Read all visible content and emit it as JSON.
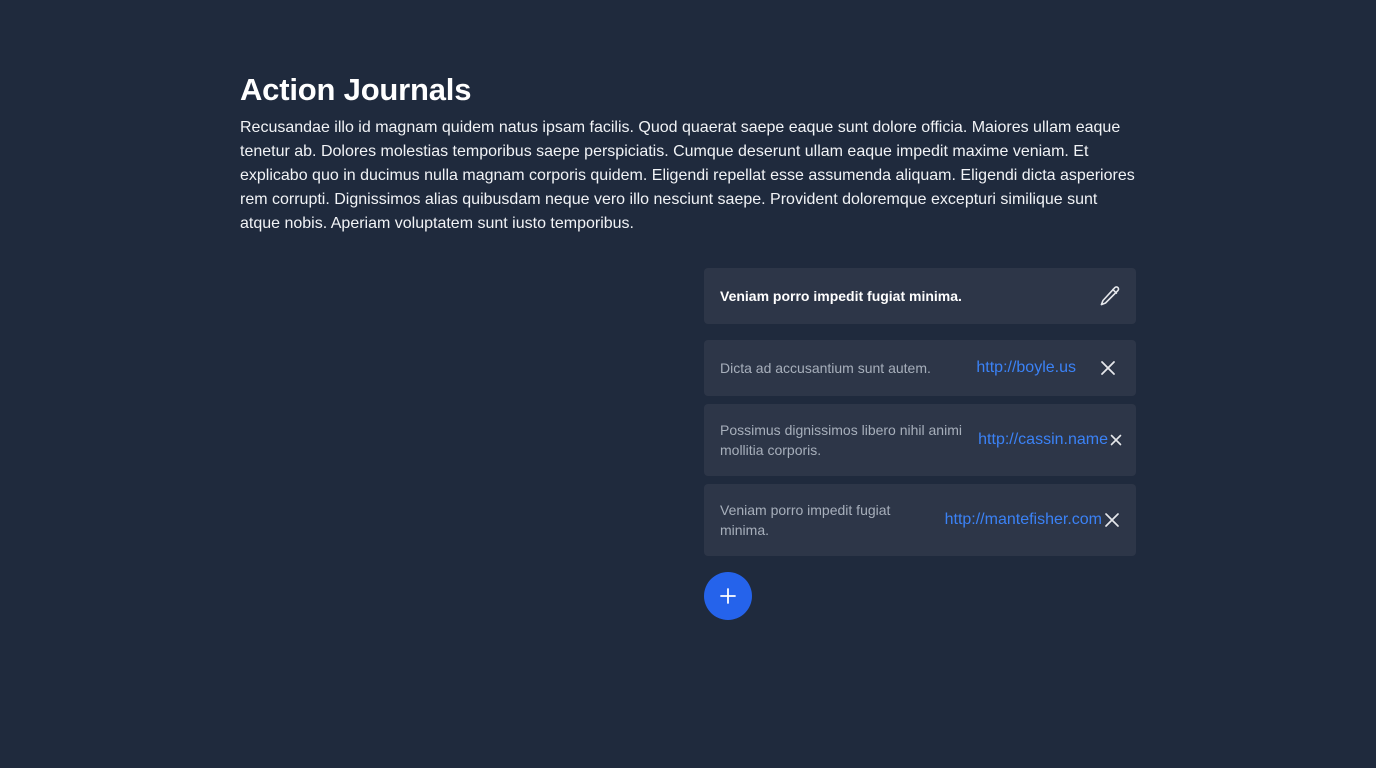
{
  "page": {
    "title": "Action Journals",
    "description": "Recusandae illo id magnam quidem natus ipsam facilis. Quod quaerat saepe eaque sunt dolore officia. Maiores ullam eaque tenetur ab. Dolores molestias temporibus saepe perspiciatis. Cumque deserunt ullam eaque impedit maxime veniam. Et explicabo quo in ducimus nulla magnam corporis quidem. Eligendi repellat esse assumenda aliquam. Eligendi dicta asperiores rem corrupti. Dignissimos alias quibusdam neque vero illo nesciunt saepe. Provident doloremque excepturi similique sunt atque nobis. Aperiam voluptatem sunt iusto temporibus."
  },
  "panel": {
    "header_title": "Veniam porro impedit fugiat minima.",
    "edit_icon": "pencil-icon",
    "items": [
      {
        "description": "Dicta ad accusantium sunt autem.",
        "link": "http://boyle.us",
        "remove_icon": "close-icon"
      },
      {
        "description": "Possimus dignissimos libero nihil animi mollitia corporis.",
        "link": "http://cassin.name",
        "remove_icon": "close-icon"
      },
      {
        "description": "Veniam porro impedit fugiat minima.",
        "link": "http://mantefisher.com",
        "remove_icon": "close-icon"
      }
    ],
    "add_icon": "plus-icon"
  },
  "colors": {
    "background": "#1f2a3d",
    "card": "#2d3648",
    "link": "#3b82f6",
    "accent": "#2563eb"
  }
}
